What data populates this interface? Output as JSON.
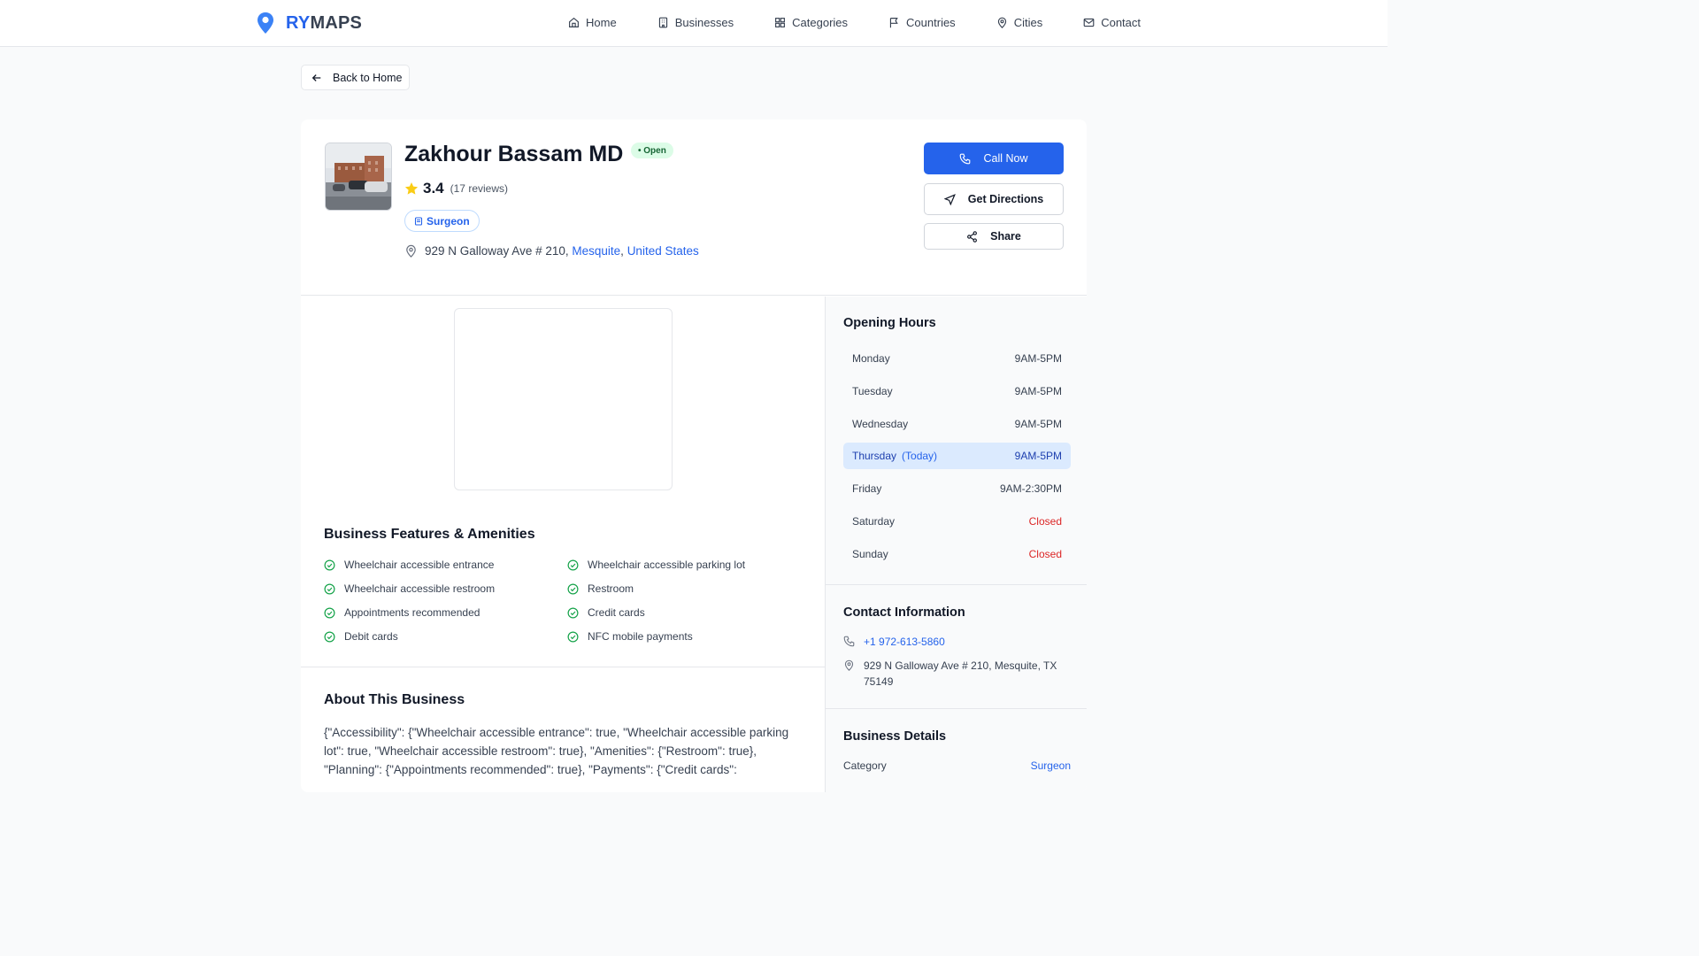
{
  "brand": {
    "prefix": "RY",
    "suffix": "MAPS"
  },
  "nav": [
    {
      "label": "Home",
      "icon": "home-icon"
    },
    {
      "label": "Businesses",
      "icon": "building-icon"
    },
    {
      "label": "Categories",
      "icon": "grid-icon"
    },
    {
      "label": "Countries",
      "icon": "flag-icon"
    },
    {
      "label": "Cities",
      "icon": "map-pin-icon"
    },
    {
      "label": "Contact",
      "icon": "mail-icon"
    }
  ],
  "back_label": "Back to Home",
  "business": {
    "name": "Zakhour Bassam MD",
    "status": "• Open",
    "rating": "3.4",
    "reviews": "(17 reviews)",
    "category": "Surgeon",
    "street": "929 N Galloway Ave # 210,",
    "city": "Mesquite",
    "sep": ",",
    "country": "United States"
  },
  "actions": {
    "call": "Call Now",
    "directions": "Get Directions",
    "share": "Share"
  },
  "features": {
    "title": "Business Features & Amenities",
    "items": [
      "Wheelchair accessible entrance",
      "Wheelchair accessible parking lot",
      "Wheelchair accessible restroom",
      "Restroom",
      "Appointments recommended",
      "Credit cards",
      "Debit cards",
      "NFC mobile payments"
    ]
  },
  "about": {
    "title": "About This Business",
    "text": "{\"Accessibility\": {\"Wheelchair accessible entrance\": true, \"Wheelchair accessible parking lot\": true, \"Wheelchair accessible restroom\": true}, \"Amenities\": {\"Restroom\": true}, \"Planning\": {\"Appointments recommended\": true}, \"Payments\": {\"Credit cards\":"
  },
  "hours": {
    "title": "Opening Hours",
    "today_tag": "(Today)",
    "rows": [
      {
        "day": "Monday",
        "time": "9AM-5PM"
      },
      {
        "day": "Tuesday",
        "time": "9AM-5PM"
      },
      {
        "day": "Wednesday",
        "time": "9AM-5PM"
      },
      {
        "day": "Thursday",
        "time": "9AM-5PM"
      },
      {
        "day": "Friday",
        "time": "9AM-2:30PM"
      },
      {
        "day": "Saturday",
        "time": "Closed"
      },
      {
        "day": "Sunday",
        "time": "Closed"
      }
    ]
  },
  "contact": {
    "title": "Contact Information",
    "phone": "+1 972-613-5860",
    "address": "929 N Galloway Ave # 210, Mesquite, TX 75149"
  },
  "details": {
    "title": "Business Details",
    "category_label": "Category",
    "category_value": "Surgeon"
  },
  "colors": {
    "accent": "#2563eb",
    "open_bg": "#dcfce7",
    "closed": "#dc2626",
    "today_bg": "#dbeafe",
    "check": "#16a34a",
    "star": "#facc15"
  }
}
